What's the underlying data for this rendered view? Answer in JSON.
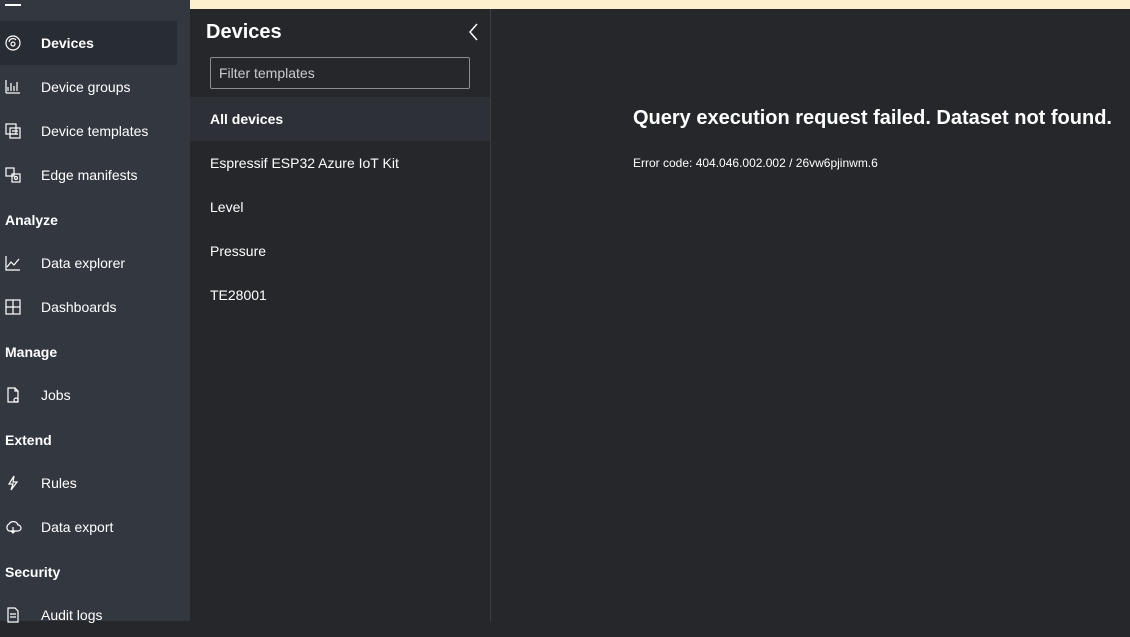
{
  "nav": {
    "items": [
      {
        "label": "Devices",
        "icon": "devices-icon",
        "selected": true
      },
      {
        "label": "Device groups",
        "icon": "device-groups-icon"
      },
      {
        "label": "Device templates",
        "icon": "device-templates-icon"
      },
      {
        "label": "Edge manifests",
        "icon": "edge-manifests-icon"
      },
      {
        "label": "Data explorer",
        "icon": "data-explorer-icon"
      },
      {
        "label": "Dashboards",
        "icon": "dashboards-icon"
      },
      {
        "label": "Jobs",
        "icon": "jobs-icon"
      },
      {
        "label": "Rules",
        "icon": "rules-icon"
      },
      {
        "label": "Data export",
        "icon": "data-export-icon"
      },
      {
        "label": "Audit logs",
        "icon": "audit-logs-icon"
      }
    ],
    "sections": {
      "analyze": "Analyze",
      "manage": "Manage",
      "extend": "Extend",
      "security": "Security"
    }
  },
  "panel": {
    "title": "Devices",
    "filter_placeholder": "Filter templates",
    "items": [
      {
        "label": "All devices",
        "selected": true
      },
      {
        "label": "Espressif ESP32 Azure IoT Kit"
      },
      {
        "label": "Level"
      },
      {
        "label": "Pressure"
      },
      {
        "label": "TE28001"
      }
    ]
  },
  "main": {
    "error_title": "Query execution request failed. Dataset not found.",
    "error_code": "Error code: 404.046.002.002 / 26vw6pjinwm.6"
  },
  "colors": {
    "nav_bg": "#333840",
    "content_bg": "#25272b",
    "banner_bg": "#fdf0cf",
    "text": "#ffffff"
  }
}
